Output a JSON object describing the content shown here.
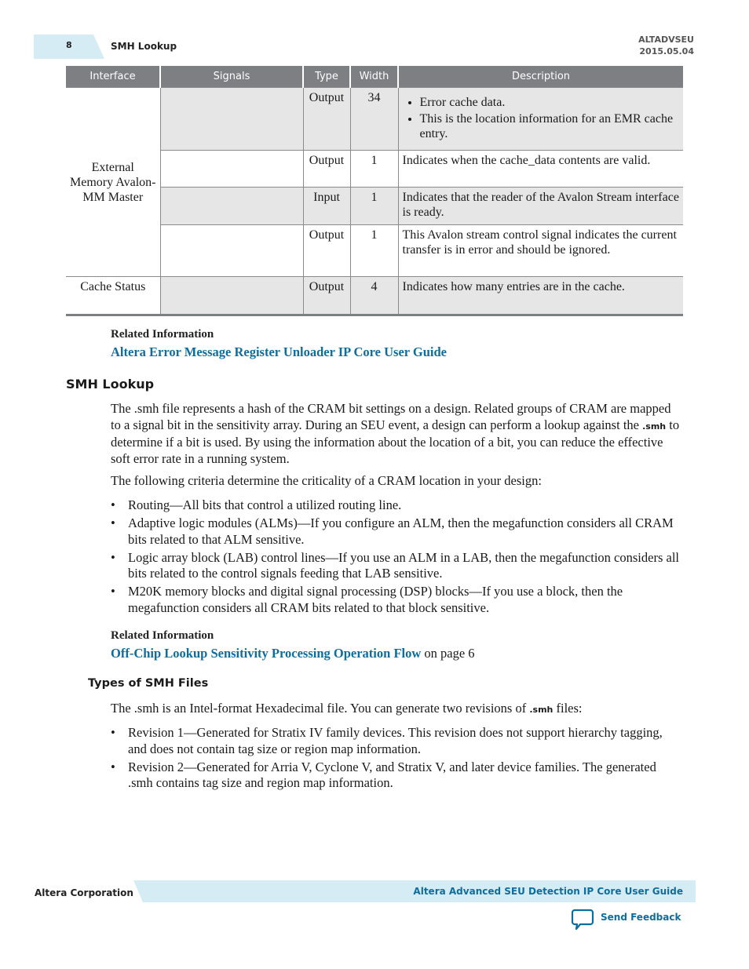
{
  "header": {
    "page_number": "8",
    "section_title": "SMH Lookup",
    "doc_id": "ALTADVSEU",
    "doc_date": "2015.05.04"
  },
  "table": {
    "columns": [
      "Interface",
      "Signals",
      "Type",
      "Width",
      "Description"
    ],
    "groups": [
      {
        "interface": "External Memory Avalon-MM Master",
        "rows": [
          {
            "signal": "",
            "type": "Output",
            "width": "34",
            "description_items": [
              "Error cache data.",
              "This is the location information for an EMR cache entry."
            ]
          },
          {
            "signal": "",
            "type": "Output",
            "width": "1",
            "description": "Indicates when the cache_data contents are valid."
          },
          {
            "signal": "",
            "type": "Input",
            "width": "1",
            "description": "Indicates that the reader of the Avalon Stream interface is ready."
          },
          {
            "signal": "",
            "type": "Output",
            "width": "1",
            "description": "This Avalon stream control signal indicates the current transfer is in error and should be ignored."
          }
        ]
      },
      {
        "interface": "Cache Status",
        "rows": [
          {
            "signal": "",
            "type": "Output",
            "width": "4",
            "description": "Indicates how many entries are in the cache."
          }
        ]
      }
    ]
  },
  "related_1": {
    "label": "Related Information",
    "link": "Altera Error Message Register Unloader IP Core User Guide"
  },
  "smh_lookup": {
    "heading": "SMH Lookup",
    "para1_a": "The .smh file represents a hash of the CRAM bit settings on a design. Related groups of CRAM are mapped to a signal bit in the sensitivity array. During an SEU event, a design can perform a lookup against the ",
    "para1_code": ".smh",
    "para1_b": " to determine if a bit is used. By using the information about the location of a bit, you can reduce the effective soft error rate in a running system.",
    "para2": "The following criteria determine the criticality of a CRAM location in your design:",
    "bullets": [
      "Routing—All bits that control a utilized routing line.",
      "Adaptive logic modules (ALMs)—If you configure an ALM, then the megafunction considers all CRAM bits related to that ALM sensitive.",
      "Logic array block (LAB) control lines—If you use an ALM in a LAB, then the megafunction considers all bits related to the control signals feeding that LAB sensitive.",
      "M20K memory blocks and digital signal processing (DSP) blocks—If you use a block, then the megafunction considers all CRAM bits related to that block sensitive."
    ]
  },
  "related_2": {
    "label": "Related Information",
    "link": "Off-Chip Lookup Sensitivity Processing Operation Flow",
    "suffix": " on page 6"
  },
  "types_of_smh": {
    "heading": "Types of SMH Files",
    "para_a": "The .smh is an Intel-format Hexadecimal file. You can generate two revisions of ",
    "para_code": ".smh",
    "para_b": " files:",
    "bullets": [
      "Revision 1—Generated for Stratix IV family devices. This revision does not support hierarchy tagging, and does not contain tag size or region map information.",
      "Revision 2—Generated for Arria V, Cyclone V, and Stratix V, and later device families. The generated .smh contains tag size and region map information."
    ]
  },
  "footer": {
    "company": "Altera Corporation",
    "guide_title": "Altera Advanced SEU Detection IP Core User Guide",
    "feedback_label": "Send Feedback",
    "feedback_icon": "speech-bubble-icon"
  },
  "colors": {
    "link_blue": "#0d6e9e",
    "header_tab": "#d6ecf4",
    "table_header": "#7d7f83",
    "row_shade": "#e6e6e6"
  }
}
